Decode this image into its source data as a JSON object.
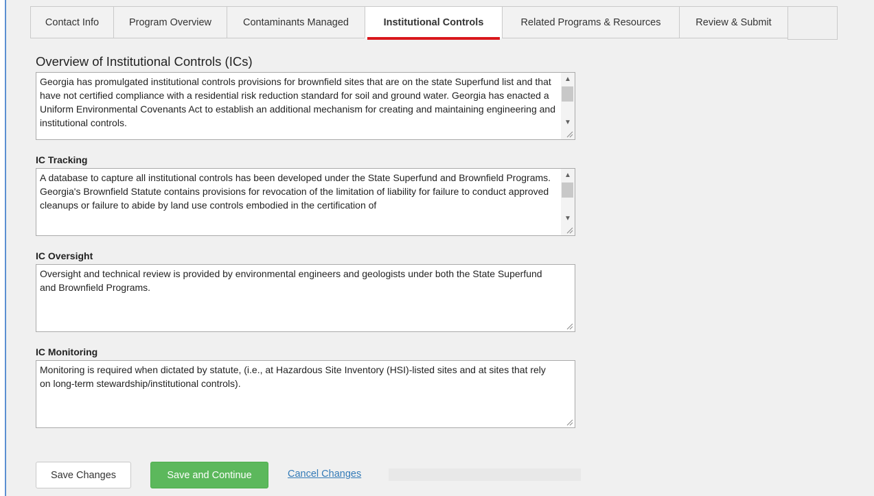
{
  "tabs": [
    {
      "label": "Contact Info"
    },
    {
      "label": "Program Overview"
    },
    {
      "label": "Contaminants Managed"
    },
    {
      "label": "Institutional Controls"
    },
    {
      "label": "Related Programs & Resources"
    },
    {
      "label": "Review & Submit"
    }
  ],
  "active_tab": "Institutional Controls",
  "page_title": "Overview of Institutional Controls (ICs)",
  "overview": {
    "text": "Georgia has promulgated institutional controls provisions for brownfield sites that are on the state Superfund list and that have not certified compliance with a residential risk reduction standard for soil and ground water. Georgia has enacted a Uniform Environmental Covenants Act to establish an additional mechanism for creating and maintaining engineering and institutional controls."
  },
  "ic_tracking": {
    "label": "IC Tracking",
    "line1": "A database to capture all institutional controls has been developed under the State Superfund and Brownfield Programs.",
    "line2": "Georgia's Brownfield Statute contains provisions for revocation of the limitation of liability for failure to conduct approved cleanups or failure to abide by land use controls embodied in the certification of"
  },
  "ic_oversight": {
    "label": "IC Oversight",
    "text": "Oversight and technical review is provided by environmental engineers and geologists under both the State Superfund and Brownfield Programs."
  },
  "ic_monitoring": {
    "label": "IC Monitoring",
    "text": "Monitoring is required when dictated by statute, (i.e., at Hazardous Site Inventory (HSI)-listed sites and at sites that rely on long-term stewardship/institutional controls)."
  },
  "buttons": {
    "save": "Save Changes",
    "save_continue": "Save and Continue",
    "cancel": "Cancel Changes"
  },
  "colors": {
    "active_tab_underline": "#d9171c",
    "primary_button": "#5cb85c",
    "link": "#337ab7"
  }
}
